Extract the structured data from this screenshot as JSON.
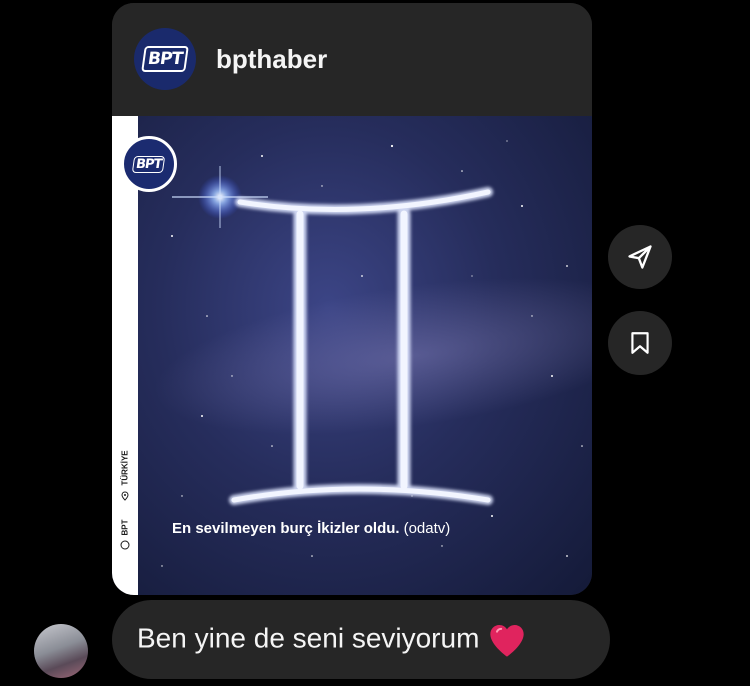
{
  "post": {
    "username": "bpthaber",
    "logo_text": "BPT",
    "caption_bold": "En sevilmeyen burç İkizler oldu.",
    "caption_source": "(odatv)",
    "strip_country": "TÜRKİYE",
    "strip_brand": "BPT"
  },
  "actions": {
    "share_icon": "paper-plane-icon",
    "save_icon": "bookmark-icon"
  },
  "message": {
    "text": "Ben yine de seni seviyorum",
    "emoji": "heart-icon"
  },
  "colors": {
    "background": "#000000",
    "bubble": "#262626",
    "heart": "#e0245e",
    "brand_blue": "#1b2b70"
  }
}
